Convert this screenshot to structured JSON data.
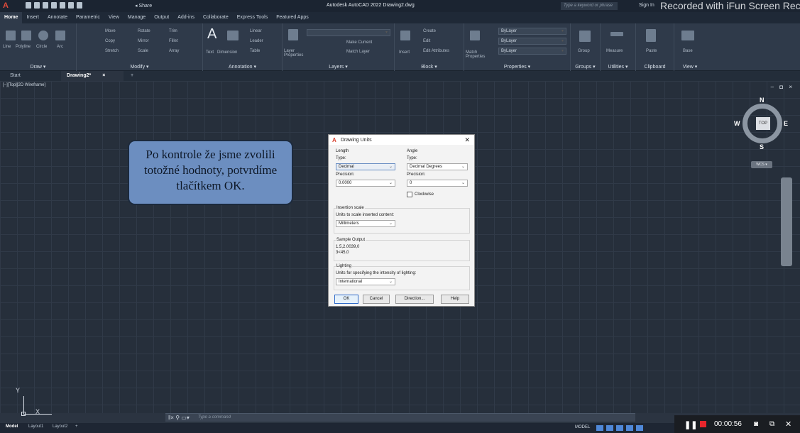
{
  "titlebar": {
    "share": "Share",
    "app_title": "Autodesk AutoCAD 2022   Drawing2.dwg",
    "search_placeholder": "Type a keyword or phrase",
    "signin": "Sign In",
    "watermark": "Recorded with iFun Screen Recorder"
  },
  "menu_tabs": [
    "Home",
    "Insert",
    "Annotate",
    "Parametric",
    "View",
    "Manage",
    "Output",
    "Add-ins",
    "Collaborate",
    "Express Tools",
    "Featured Apps"
  ],
  "ribbon": {
    "draw": {
      "title": "Draw ▾",
      "tools": [
        "Line",
        "Polyline",
        "Circle",
        "Arc"
      ]
    },
    "modify": {
      "title": "Modify ▾",
      "tools": [
        "Move",
        "Rotate",
        "Trim",
        "Copy",
        "Mirror",
        "Fillet",
        "Stretch",
        "Scale",
        "Array"
      ]
    },
    "annotation": {
      "title": "Annotation ▾",
      "tools": [
        "Text",
        "Dimension",
        "Linear",
        "Leader",
        "Table"
      ]
    },
    "layers": {
      "title": "Layers ▾",
      "tools": [
        "Layer Properties",
        "Make Current",
        "Match Layer"
      ]
    },
    "block": {
      "title": "Block ▾",
      "tools": [
        "Insert",
        "Create",
        "Edit",
        "Edit Attributes"
      ]
    },
    "properties": {
      "title": "Properties ▾",
      "tools": [
        "Match Properties",
        "ByLayer",
        "ByLayer",
        "ByLayer"
      ]
    },
    "groups": {
      "title": "Groups ▾",
      "tools": [
        "Group"
      ]
    },
    "utilities": {
      "title": "Utilities ▾",
      "tools": [
        "Measure"
      ]
    },
    "clipboard": {
      "title": "Clipboard",
      "tools": [
        "Paste"
      ]
    },
    "view": {
      "title": "View ▾",
      "tools": [
        "Base"
      ]
    }
  },
  "doc_tabs": {
    "start": "Start",
    "drawing": "Drawing2*",
    "close": "×",
    "add": "+"
  },
  "canvas": {
    "view_label": "[−][Top][2D Wireframe]",
    "view_controls": "– ◘ ×",
    "viewcube": {
      "n": "N",
      "s": "S",
      "e": "E",
      "w": "W",
      "top": "TOP",
      "wcs": "WCS ▾"
    },
    "ucs_x": "X",
    "ucs_y": "Y"
  },
  "callout": {
    "line1": "Po kontrole že jsme zvolili",
    "line2": "totožné hodnoty, potvrdíme",
    "line3": "tlačítkem OK."
  },
  "dialog": {
    "title": "Drawing Units",
    "close": "✕",
    "length": {
      "group": "Length",
      "type_label": "Type:",
      "type_value": "Decimal",
      "precision_label": "Precision:",
      "precision_value": "0.0000"
    },
    "angle": {
      "group": "Angle",
      "type_label": "Type:",
      "type_value": "Decimal Degrees",
      "precision_label": "Precision:",
      "precision_value": "0",
      "clockwise_label": "Clockwise"
    },
    "insertion": {
      "group": "Insertion scale",
      "label": "Units to scale inserted content:",
      "value": "Millimeters"
    },
    "sample": {
      "group": "Sample Output",
      "line1": "1.5,2.0039,0",
      "line2": "3<45,0"
    },
    "lighting": {
      "group": "Lighting",
      "label": "Units for specifying the intensity of lighting:",
      "value": "International"
    },
    "buttons": {
      "ok": "OK",
      "cancel": "Cancel",
      "direction": "Direction...",
      "help": "Help"
    }
  },
  "cmdline": {
    "placeholder": "Type a command"
  },
  "statusbar": {
    "model_tab": "Model",
    "layout1": "Layout1",
    "layout2": "Layout2",
    "add": "+",
    "model": "MODEL"
  },
  "recorder": {
    "time": "00:00:56"
  }
}
